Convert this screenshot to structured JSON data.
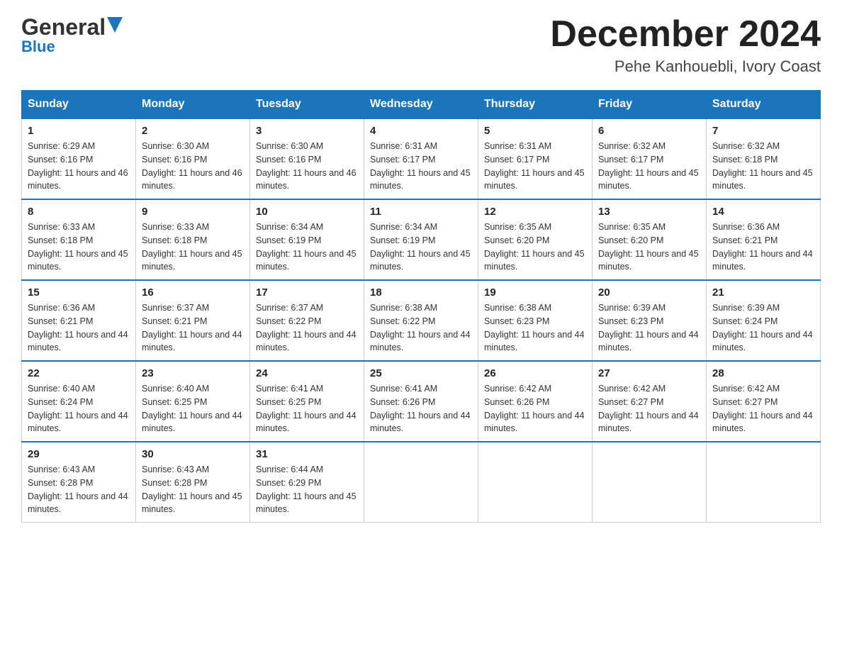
{
  "header": {
    "logo_line1": "General",
    "logo_line2": "Blue",
    "month_title": "December 2024",
    "location": "Pehe Kanhouebli, Ivory Coast"
  },
  "days_of_week": [
    "Sunday",
    "Monday",
    "Tuesday",
    "Wednesday",
    "Thursday",
    "Friday",
    "Saturday"
  ],
  "weeks": [
    [
      {
        "day": "1",
        "sunrise": "6:29 AM",
        "sunset": "6:16 PM",
        "daylight": "11 hours and 46 minutes."
      },
      {
        "day": "2",
        "sunrise": "6:30 AM",
        "sunset": "6:16 PM",
        "daylight": "11 hours and 46 minutes."
      },
      {
        "day": "3",
        "sunrise": "6:30 AM",
        "sunset": "6:16 PM",
        "daylight": "11 hours and 46 minutes."
      },
      {
        "day": "4",
        "sunrise": "6:31 AM",
        "sunset": "6:17 PM",
        "daylight": "11 hours and 45 minutes."
      },
      {
        "day": "5",
        "sunrise": "6:31 AM",
        "sunset": "6:17 PM",
        "daylight": "11 hours and 45 minutes."
      },
      {
        "day": "6",
        "sunrise": "6:32 AM",
        "sunset": "6:17 PM",
        "daylight": "11 hours and 45 minutes."
      },
      {
        "day": "7",
        "sunrise": "6:32 AM",
        "sunset": "6:18 PM",
        "daylight": "11 hours and 45 minutes."
      }
    ],
    [
      {
        "day": "8",
        "sunrise": "6:33 AM",
        "sunset": "6:18 PM",
        "daylight": "11 hours and 45 minutes."
      },
      {
        "day": "9",
        "sunrise": "6:33 AM",
        "sunset": "6:18 PM",
        "daylight": "11 hours and 45 minutes."
      },
      {
        "day": "10",
        "sunrise": "6:34 AM",
        "sunset": "6:19 PM",
        "daylight": "11 hours and 45 minutes."
      },
      {
        "day": "11",
        "sunrise": "6:34 AM",
        "sunset": "6:19 PM",
        "daylight": "11 hours and 45 minutes."
      },
      {
        "day": "12",
        "sunrise": "6:35 AM",
        "sunset": "6:20 PM",
        "daylight": "11 hours and 45 minutes."
      },
      {
        "day": "13",
        "sunrise": "6:35 AM",
        "sunset": "6:20 PM",
        "daylight": "11 hours and 45 minutes."
      },
      {
        "day": "14",
        "sunrise": "6:36 AM",
        "sunset": "6:21 PM",
        "daylight": "11 hours and 44 minutes."
      }
    ],
    [
      {
        "day": "15",
        "sunrise": "6:36 AM",
        "sunset": "6:21 PM",
        "daylight": "11 hours and 44 minutes."
      },
      {
        "day": "16",
        "sunrise": "6:37 AM",
        "sunset": "6:21 PM",
        "daylight": "11 hours and 44 minutes."
      },
      {
        "day": "17",
        "sunrise": "6:37 AM",
        "sunset": "6:22 PM",
        "daylight": "11 hours and 44 minutes."
      },
      {
        "day": "18",
        "sunrise": "6:38 AM",
        "sunset": "6:22 PM",
        "daylight": "11 hours and 44 minutes."
      },
      {
        "day": "19",
        "sunrise": "6:38 AM",
        "sunset": "6:23 PM",
        "daylight": "11 hours and 44 minutes."
      },
      {
        "day": "20",
        "sunrise": "6:39 AM",
        "sunset": "6:23 PM",
        "daylight": "11 hours and 44 minutes."
      },
      {
        "day": "21",
        "sunrise": "6:39 AM",
        "sunset": "6:24 PM",
        "daylight": "11 hours and 44 minutes."
      }
    ],
    [
      {
        "day": "22",
        "sunrise": "6:40 AM",
        "sunset": "6:24 PM",
        "daylight": "11 hours and 44 minutes."
      },
      {
        "day": "23",
        "sunrise": "6:40 AM",
        "sunset": "6:25 PM",
        "daylight": "11 hours and 44 minutes."
      },
      {
        "day": "24",
        "sunrise": "6:41 AM",
        "sunset": "6:25 PM",
        "daylight": "11 hours and 44 minutes."
      },
      {
        "day": "25",
        "sunrise": "6:41 AM",
        "sunset": "6:26 PM",
        "daylight": "11 hours and 44 minutes."
      },
      {
        "day": "26",
        "sunrise": "6:42 AM",
        "sunset": "6:26 PM",
        "daylight": "11 hours and 44 minutes."
      },
      {
        "day": "27",
        "sunrise": "6:42 AM",
        "sunset": "6:27 PM",
        "daylight": "11 hours and 44 minutes."
      },
      {
        "day": "28",
        "sunrise": "6:42 AM",
        "sunset": "6:27 PM",
        "daylight": "11 hours and 44 minutes."
      }
    ],
    [
      {
        "day": "29",
        "sunrise": "6:43 AM",
        "sunset": "6:28 PM",
        "daylight": "11 hours and 44 minutes."
      },
      {
        "day": "30",
        "sunrise": "6:43 AM",
        "sunset": "6:28 PM",
        "daylight": "11 hours and 45 minutes."
      },
      {
        "day": "31",
        "sunrise": "6:44 AM",
        "sunset": "6:29 PM",
        "daylight": "11 hours and 45 minutes."
      },
      null,
      null,
      null,
      null
    ]
  ],
  "labels": {
    "sunrise_prefix": "Sunrise: ",
    "sunset_prefix": "Sunset: ",
    "daylight_prefix": "Daylight: "
  }
}
